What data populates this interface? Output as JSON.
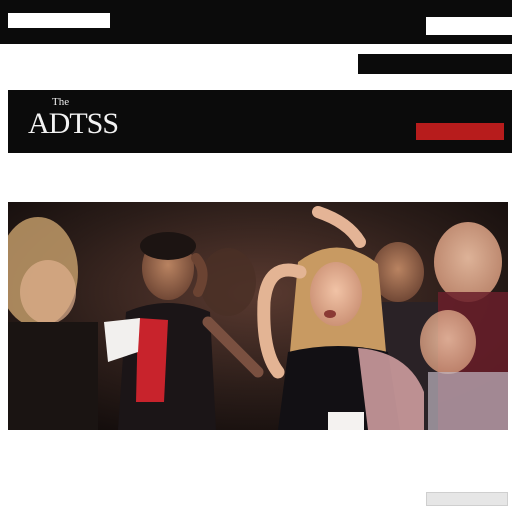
{
  "topbar": {
    "left_label": "",
    "center_label": "",
    "right_links": [
      "",
      ""
    ],
    "search_placeholder": "",
    "nav": [
      "",
      "",
      "",
      "",
      "",
      "",
      "",
      "",
      ""
    ]
  },
  "subrow": {
    "crumbs": ""
  },
  "masthead": {
    "small_title": "The",
    "brand": "ADTSS",
    "top_links": [
      "",
      "",
      ""
    ],
    "sections": [
      "",
      "",
      "",
      "",
      ""
    ],
    "subscribe_label": ""
  },
  "headline": "",
  "caption": {
    "line1": "",
    "line2": "",
    "line3": "",
    "red_fragment": ""
  },
  "sub_headline": "",
  "share_label": ""
}
